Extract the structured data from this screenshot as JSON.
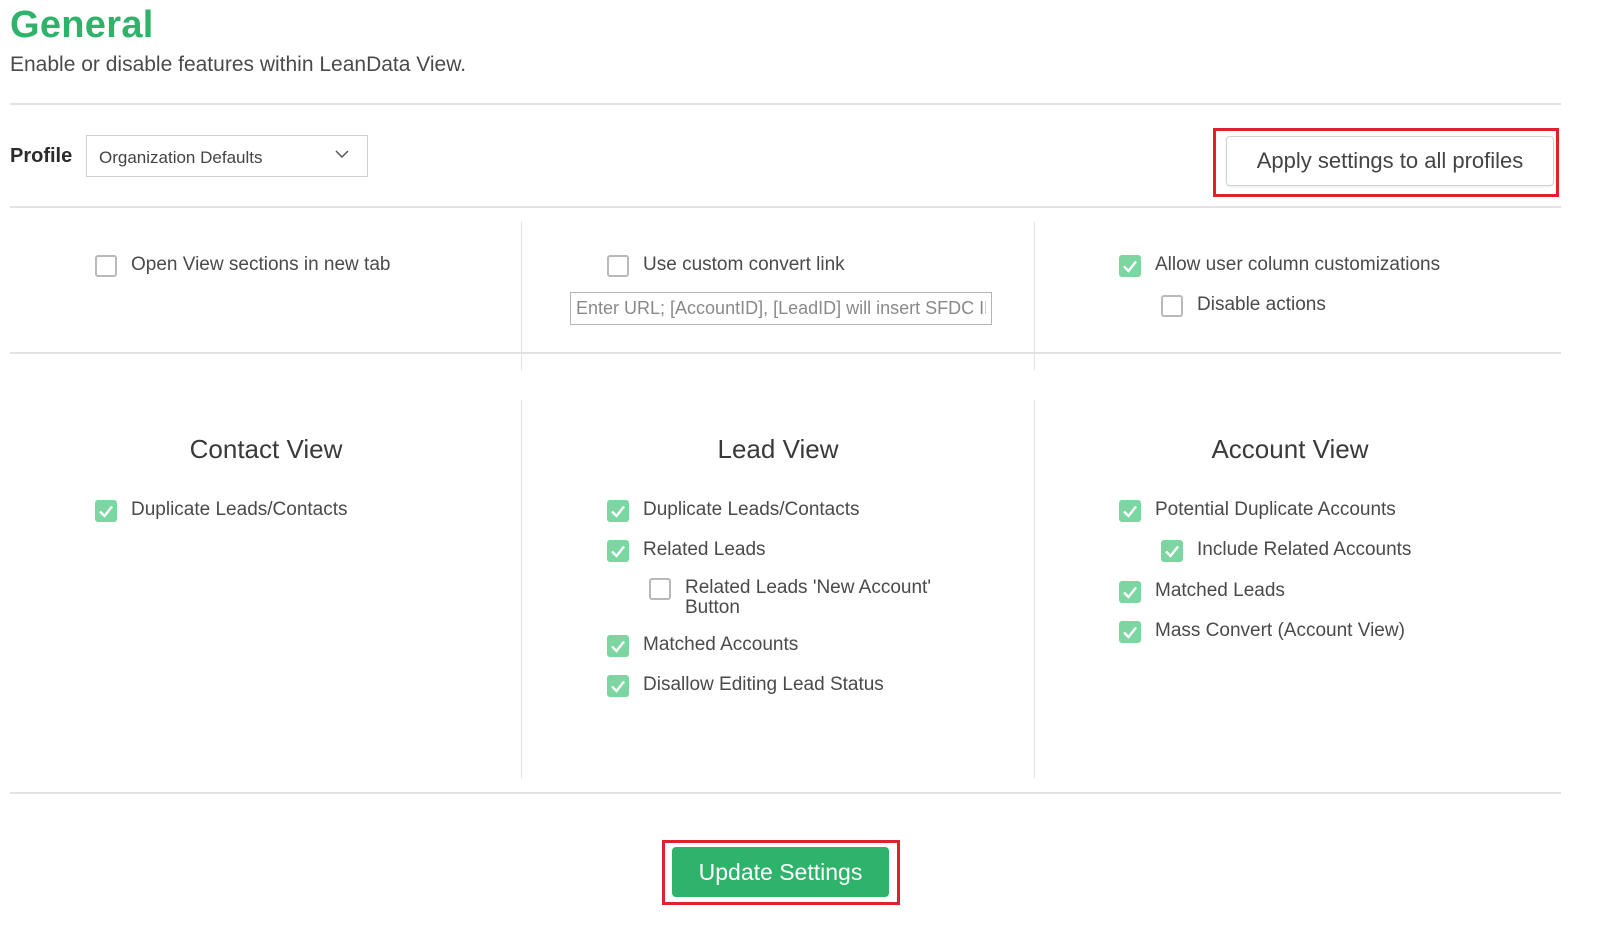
{
  "header": {
    "title": "General",
    "subtitle": "Enable or disable features within LeanData View."
  },
  "profile": {
    "label": "Profile",
    "selected": "Organization Defaults",
    "apply_button": "Apply settings to all profiles"
  },
  "top_options": {
    "open_new_tab": {
      "label": "Open View sections in new tab",
      "checked": false
    },
    "custom_convert_link": {
      "label": "Use custom convert link",
      "checked": false,
      "placeholder": "Enter URL; [AccountID], [LeadID] will insert SFDC ID"
    },
    "allow_column_customizations": {
      "label": "Allow user column customizations",
      "checked": true
    },
    "disable_actions": {
      "label": "Disable actions",
      "checked": false
    }
  },
  "contact_view": {
    "title": "Contact View",
    "items": [
      {
        "label": "Duplicate Leads/Contacts",
        "checked": true
      }
    ]
  },
  "lead_view": {
    "title": "Lead View",
    "items": [
      {
        "label": "Duplicate Leads/Contacts",
        "checked": true
      },
      {
        "label": "Related Leads",
        "checked": true
      },
      {
        "label_line1": "Related Leads 'New Account'",
        "label_line2": "Button",
        "checked": false
      },
      {
        "label": "Matched Accounts",
        "checked": true
      },
      {
        "label": "Disallow Editing Lead Status",
        "checked": true
      }
    ]
  },
  "account_view": {
    "title": "Account View",
    "items": [
      {
        "label": "Potential Duplicate Accounts",
        "checked": true
      },
      {
        "label": "Include Related Accounts",
        "checked": true
      },
      {
        "label": "Matched Leads",
        "checked": true
      },
      {
        "label": "Mass Convert (Account View)",
        "checked": true
      }
    ]
  },
  "footer": {
    "update_button": "Update Settings"
  },
  "colors": {
    "brand_green": "#2fb36a",
    "checkbox_green": "#7dd6a1",
    "highlight_red": "#e0202a"
  }
}
